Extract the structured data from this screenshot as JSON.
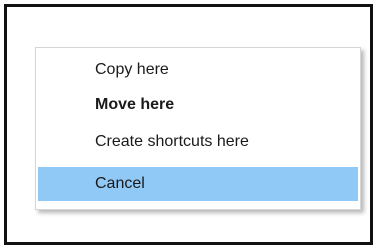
{
  "context_menu": {
    "items": [
      {
        "label": "Copy here",
        "bold": false,
        "selected": false
      },
      {
        "label": "Move here",
        "bold": true,
        "selected": false
      },
      {
        "label": "Create shortcuts here",
        "bold": false,
        "selected": false
      },
      {
        "label": "Cancel",
        "bold": false,
        "selected": true
      }
    ],
    "selected_color": "#90c8f6"
  }
}
